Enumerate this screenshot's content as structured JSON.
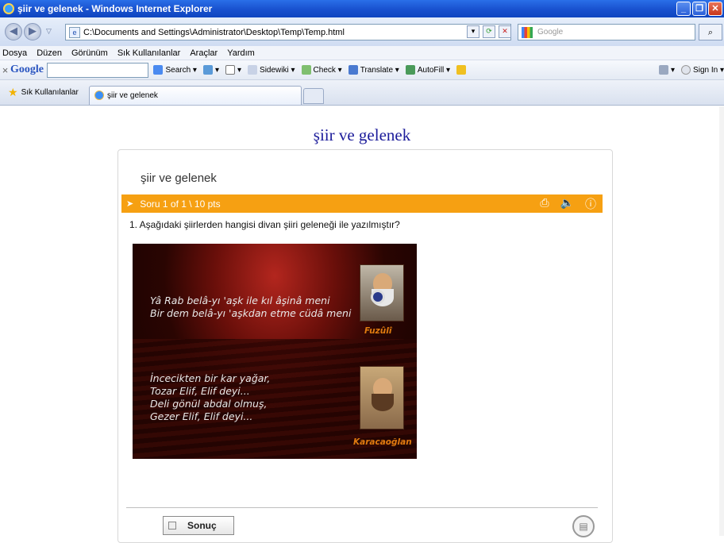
{
  "window": {
    "title": "şiir ve gelenek - Windows Internet Explorer"
  },
  "address": {
    "url": "C:\\Documents and Settings\\Administrator\\Desktop\\Temp\\Temp.html",
    "search_placeholder": "Google"
  },
  "menu": [
    "Dosya",
    "Düzen",
    "Görünüm",
    "Sık Kullanılanlar",
    "Araçlar",
    "Yardım"
  ],
  "google_toolbar": {
    "logo": "Google",
    "search_label": "Search",
    "sidewiki": "Sidewiki",
    "check": "Check",
    "translate": "Translate",
    "autofill": "AutoFill",
    "sign_in": "Sign In"
  },
  "tabs": {
    "favorites": "Sık Kullanılanlar",
    "active_tab": "şiir ve gelenek"
  },
  "page": {
    "heading": "şiir ve gelenek",
    "quiz_title": "şiir ve gelenek",
    "question_bar": "Soru 1 of 1 \\ 10 pts",
    "question": "1.  Aşağıdaki şiirlerden hangisi divan şiiri geleneği ile yazılmıştır?",
    "verse1": [
      "Yâ Rab belâ-yı 'aşk ile kıl âşinâ meni",
      "Bir dem belâ-yı 'aşkdan etme cüdâ meni"
    ],
    "verse2": [
      "İncecikten bir kar yağar,",
      "Tozar Elif, Elif deyi...",
      "Deli gönül abdal olmuş,",
      "Gezer Elif, Elif deyi..."
    ],
    "poet1": "Fuzûlî",
    "poet2": "Karacaoğlan",
    "result_button": "Sonuç"
  },
  "colors": {
    "accent": "#f6a012",
    "heading": "#1b1b9a"
  }
}
